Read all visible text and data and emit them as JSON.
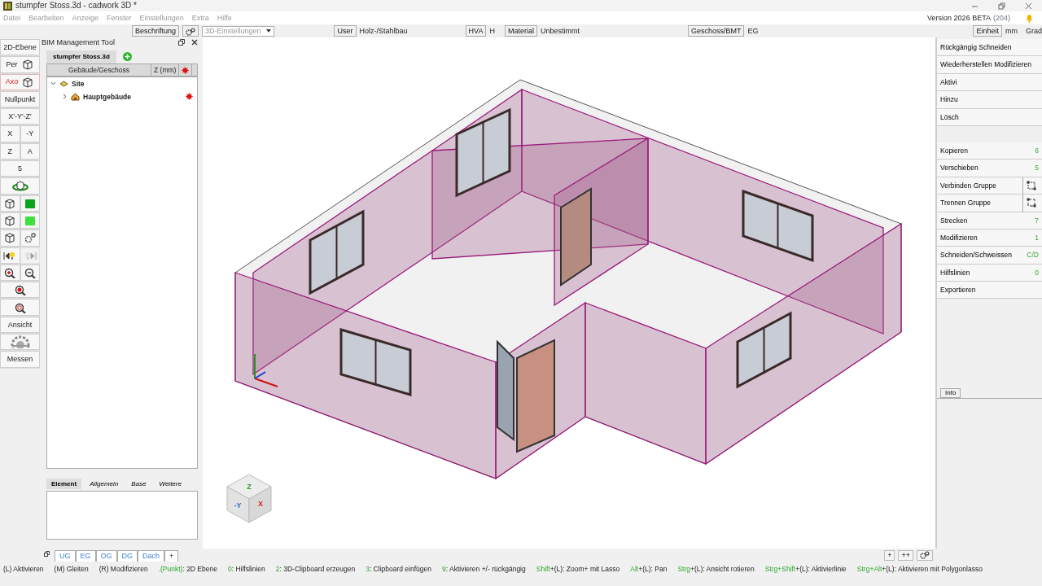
{
  "window": {
    "title": "stumpfer Stoss.3d - cadwork 3D *"
  },
  "menu": [
    "Datei",
    "Bearbeiten",
    "Anzeige",
    "Fenster",
    "Einstellungen",
    "Extra",
    "Hilfe"
  ],
  "version": {
    "label": "Version 2026 BETA",
    "build": "(204)"
  },
  "toolbar": {
    "labeling_button": "Beschriftung",
    "settings_select": "3D-Einstellungen",
    "fields": [
      {
        "button": "User",
        "value": "Holz-/Stahlbau"
      },
      {
        "button": "HVA",
        "value": "H"
      },
      {
        "button": "Material",
        "value": "Unbestimmt"
      },
      {
        "button": "Geschoss/BMT",
        "value": "EG"
      },
      {
        "button": "Einheit",
        "value": "mm"
      }
    ],
    "angle_unit": "Grad"
  },
  "tools": [
    [
      {
        "label": "2D-Ebene",
        "kind": "text",
        "selected": false,
        "disabled": false
      }
    ],
    [
      {
        "label": "Per",
        "kind": "cube",
        "selected": false,
        "disabled": false
      }
    ],
    [
      {
        "label": "Axo",
        "kind": "cube",
        "selected": true,
        "disabled": false
      }
    ],
    [
      {
        "label": "Nullpunkt",
        "kind": "text",
        "selected": false,
        "disabled": false
      }
    ],
    [
      {
        "label": "X'-Y'-Z'",
        "kind": "text",
        "selected": false,
        "disabled": false
      }
    ],
    [
      {
        "label": "X",
        "kind": "text",
        "selected": false,
        "disabled": false
      },
      {
        "label": "-Y",
        "kind": "text",
        "selected": false,
        "disabled": false
      }
    ],
    [
      {
        "label": "Z",
        "kind": "text",
        "selected": false,
        "disabled": false
      },
      {
        "label": "A",
        "kind": "text",
        "selected": false,
        "disabled": false
      }
    ],
    [
      {
        "label": "5",
        "kind": "text",
        "selected": false,
        "disabled": false
      }
    ],
    [
      {
        "kind": "orbit",
        "selected": false,
        "disabled": false
      }
    ],
    [
      {
        "kind": "cube",
        "selected": false,
        "disabled": false
      },
      {
        "kind": "solid",
        "selected": false,
        "disabled": false
      }
    ],
    [
      {
        "kind": "cube",
        "selected": false,
        "disabled": false
      },
      {
        "kind": "brightsolid",
        "selected": false,
        "disabled": false
      }
    ],
    [
      {
        "kind": "cube",
        "selected": false,
        "disabled": false
      },
      {
        "kind": "gears",
        "selected": false,
        "disabled": false
      }
    ],
    [
      {
        "kind": "lightprev",
        "selected": false,
        "disabled": false
      },
      {
        "kind": "lightnext",
        "selected": false,
        "disabled": true
      }
    ],
    [
      {
        "kind": "zoomin",
        "selected": false,
        "disabled": false
      },
      {
        "kind": "zoomout",
        "selected": false,
        "disabled": false
      }
    ],
    [
      {
        "kind": "zoomred",
        "selected": false,
        "disabled": false
      }
    ],
    [
      {
        "kind": "zoomfit",
        "selected": false,
        "disabled": false
      }
    ],
    [
      {
        "label": "Ansicht",
        "kind": "text",
        "selected": false,
        "disabled": false
      }
    ],
    [
      {
        "kind": "wheel",
        "selected": false,
        "disabled": false
      }
    ],
    [
      {
        "label": "Messen",
        "kind": "text",
        "selected": false,
        "disabled": false
      }
    ]
  ],
  "bim_panel": {
    "title": "BIM Management Tool",
    "file_tab": "stumpfer Stoss.3d",
    "columns": [
      "Gebäude/Geschoss",
      "Z (mm)"
    ],
    "tree": [
      {
        "label": "Site",
        "expanded": true,
        "children": [
          {
            "label": "Hauptgebäude",
            "expanded": false,
            "marked": true
          }
        ]
      }
    ],
    "property_tabs": [
      {
        "label": "Element",
        "selected": true
      },
      {
        "label": "Allgemein",
        "selected": false
      },
      {
        "label": "Base",
        "selected": false
      },
      {
        "label": "Weitere",
        "selected": false
      }
    ]
  },
  "view_cube": {
    "top": "Z",
    "left": "-Y",
    "right": "X"
  },
  "floor_tabs": [
    {
      "label": "UG",
      "selected": false
    },
    {
      "label": "EG",
      "selected": false
    },
    {
      "label": "OG",
      "selected": false
    },
    {
      "label": "DG",
      "selected": false
    },
    {
      "label": "Dach",
      "selected": false
    }
  ],
  "floor_add": "+",
  "view_buttons": [
    "+",
    "++"
  ],
  "right_panel": {
    "history": [
      "Rückgängig Schneiden",
      "Wiederherstellen Modifizieren"
    ],
    "selection": [
      "Aktivi",
      "Hinzu",
      "Lösch"
    ],
    "actions": [
      {
        "label": "Kopieren",
        "shortcut": "6",
        "kind": "plain"
      },
      {
        "label": "Verschieben",
        "shortcut": "5",
        "kind": "plain"
      },
      {
        "label": "Verbinden Gruppe",
        "kind": "group"
      },
      {
        "label": "Trennen Gruppe",
        "kind": "ungroup"
      },
      {
        "label": "Strecken",
        "shortcut": "7",
        "kind": "plain"
      },
      {
        "label": "Modifizieren",
        "shortcut": "1",
        "kind": "plain"
      },
      {
        "label": "Schneiden/Schweissen",
        "shortcut": "C/D",
        "kind": "plain"
      },
      {
        "label": "Hilfslinien",
        "shortcut": "0",
        "kind": "plain"
      },
      {
        "label": "Exportieren",
        "kind": "plain"
      }
    ],
    "info_tab": "Info"
  },
  "status_hints": [
    [
      {
        "text": "(L) Aktivieren",
        "kind": "plain"
      }
    ],
    [
      {
        "text": "(M) Gleiten",
        "kind": "plain"
      }
    ],
    [
      {
        "text": "(R) Modifizieren",
        "kind": "plain"
      }
    ],
    [
      {
        "text": ".(Punkt)",
        "kind": "key"
      },
      {
        "text": ": 2D Ebene",
        "kind": "plain"
      }
    ],
    [
      {
        "text": "0",
        "kind": "key"
      },
      {
        "text": ": Hilfslinien",
        "kind": "plain"
      }
    ],
    [
      {
        "text": "2",
        "kind": "key"
      },
      {
        "text": ": 3D-Clipboard erzeugen",
        "kind": "plain"
      }
    ],
    [
      {
        "text": "3",
        "kind": "key"
      },
      {
        "text": ": Clipboard einfügen",
        "kind": "plain"
      }
    ],
    [
      {
        "text": "9",
        "kind": "key"
      },
      {
        "text": ": Aktivieren +/- rückgängig",
        "kind": "plain"
      }
    ],
    [
      {
        "text": "Shift",
        "kind": "key"
      },
      {
        "text": "+(L): Zoom+ mit Lasso",
        "kind": "plain"
      }
    ],
    [
      {
        "text": "Alt",
        "kind": "key"
      },
      {
        "text": "+(L): Pan",
        "kind": "plain"
      }
    ],
    [
      {
        "text": "Strg",
        "kind": "key"
      },
      {
        "text": "+(L): Ansicht rotieren",
        "kind": "plain"
      }
    ],
    [
      {
        "text": "Strg+Shift",
        "kind": "key"
      },
      {
        "text": "+(L): Aktivierlinie",
        "kind": "plain"
      }
    ],
    [
      {
        "text": "Strg+Alt",
        "kind": "key"
      },
      {
        "text": "+(L): Aktivieren mit Polygonlasso",
        "kind": "plain"
      }
    ]
  ]
}
